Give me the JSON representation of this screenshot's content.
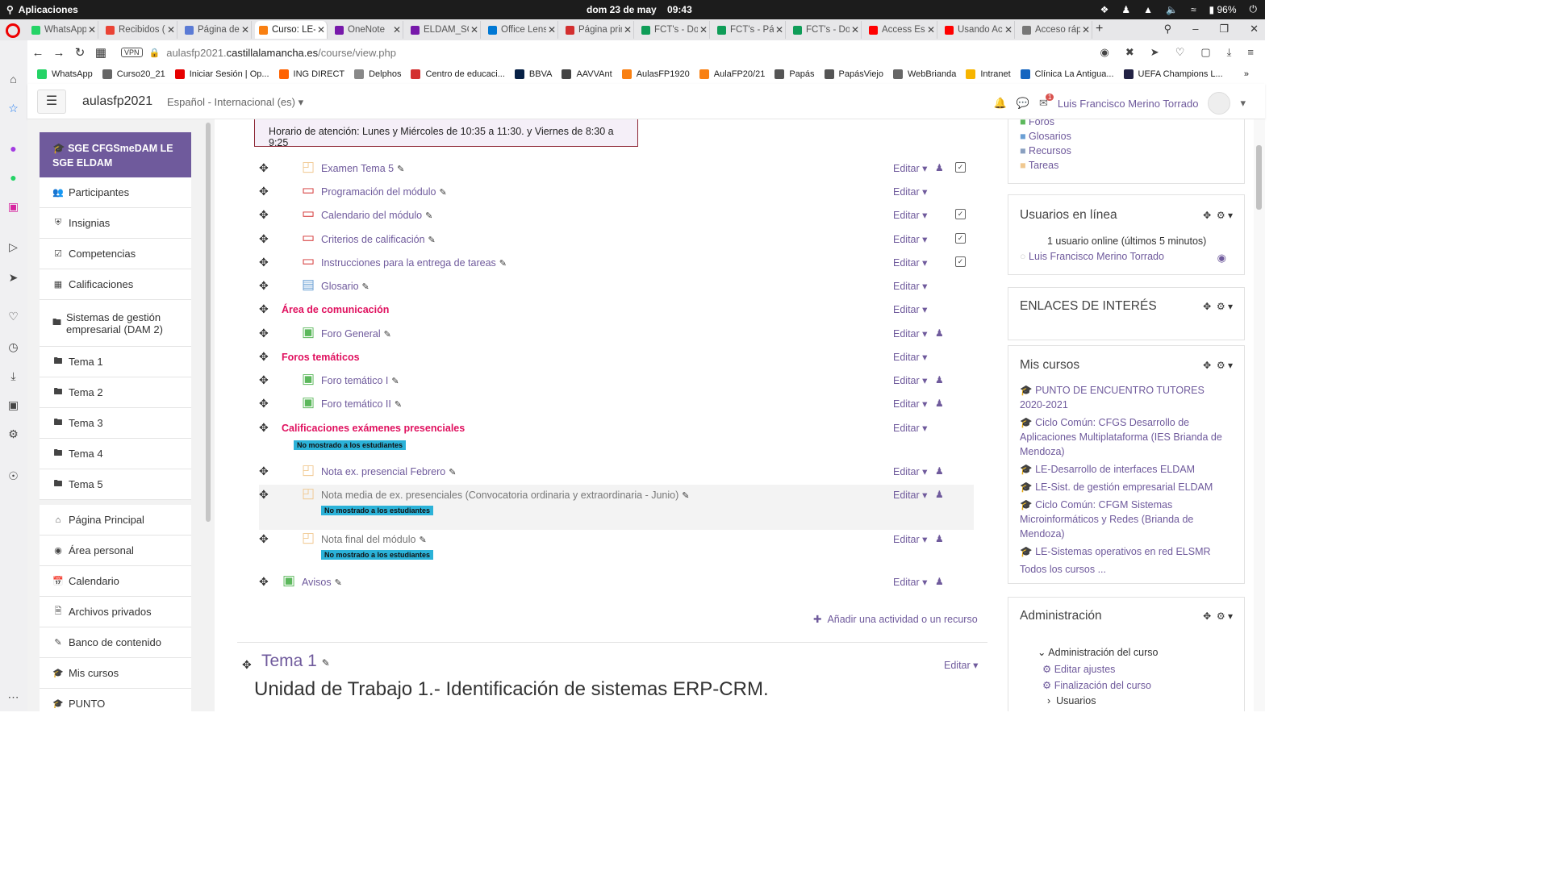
{
  "os": {
    "apps_label": "Aplicaciones",
    "date": "dom 23 de may",
    "time": "09:43",
    "battery": "96%"
  },
  "tabs": [
    {
      "label": "WhatsApp",
      "color": "#25d366"
    },
    {
      "label": "Recibidos (",
      "color": "#ea4335"
    },
    {
      "label": "Página de l",
      "color": "#5b7bd5"
    },
    {
      "label": "Curso: LE-S",
      "color": "#f98012"
    },
    {
      "label": "OneNote",
      "color": "#7719aa"
    },
    {
      "label": "ELDAM_SG",
      "color": "#7719aa"
    },
    {
      "label": "Office Lens",
      "color": "#0078d4"
    },
    {
      "label": "Página prin",
      "color": "#d32f2f"
    },
    {
      "label": "FCT's - Doc",
      "color": "#0f9d58"
    },
    {
      "label": "FCT's - Pág",
      "color": "#0f9d58"
    },
    {
      "label": "FCT's - Doc",
      "color": "#0f9d58"
    },
    {
      "label": "Access Esp",
      "color": "#ff0000"
    },
    {
      "label": "Usando Ac",
      "color": "#ff0000"
    },
    {
      "label": "Acceso ráp",
      "color": "#777777"
    }
  ],
  "address": {
    "vpn": "VPN",
    "url_pre": "aulasfp2021.",
    "url_host": "castillalamancha.es",
    "url_path": "/course/view.php"
  },
  "bookmarks": [
    {
      "label": "WhatsApp",
      "color": "#25d366"
    },
    {
      "label": "Curso20_21",
      "color": "#666666"
    },
    {
      "label": "Iniciar Sesión | Op...",
      "color": "#e60000"
    },
    {
      "label": "ING DIRECT",
      "color": "#ff6200"
    },
    {
      "label": "Delphos",
      "color": "#888888"
    },
    {
      "label": "Centro de educaci...",
      "color": "#d32f2f"
    },
    {
      "label": "BBVA",
      "color": "#072146"
    },
    {
      "label": "AAVVAnt",
      "color": "#444444"
    },
    {
      "label": "AulasFP1920",
      "color": "#f98012"
    },
    {
      "label": "AulaFP20/21",
      "color": "#f98012"
    },
    {
      "label": "Papás",
      "color": "#555555"
    },
    {
      "label": "PapásViejo",
      "color": "#555555"
    },
    {
      "label": "WebBrianda",
      "color": "#666666"
    },
    {
      "label": "Intranet",
      "color": "#f7b500"
    },
    {
      "label": "Clínica La Antigua...",
      "color": "#1565c0"
    },
    {
      "label": "UEFA Champions L...",
      "color": "#222244"
    }
  ],
  "navbar": {
    "site_name": "aulasfp2021",
    "language": "Español - Internacional (es)",
    "user_name": "Luis Francisco Merino Torrado",
    "notif_count": "1"
  },
  "drawer": {
    "course": "SGE CFGSmeDAM LE SGE ELDAM",
    "items": [
      {
        "label": "Participantes",
        "icon": "users-icon"
      },
      {
        "label": "Insignias",
        "icon": "shield-icon"
      },
      {
        "label": "Competencias",
        "icon": "checkbox-icon"
      },
      {
        "label": "Calificaciones",
        "icon": "table-icon"
      },
      {
        "label": "Sistemas de gestión empresarial (DAM 2)",
        "icon": "folder-icon"
      },
      {
        "label": "Tema 1",
        "icon": "folder-icon"
      },
      {
        "label": "Tema 2",
        "icon": "folder-icon"
      },
      {
        "label": "Tema 3",
        "icon": "folder-icon"
      },
      {
        "label": "Tema 4",
        "icon": "folder-icon"
      },
      {
        "label": "Tema 5",
        "icon": "folder-icon"
      }
    ],
    "items2": [
      {
        "label": "Página Principal",
        "icon": "home-icon"
      },
      {
        "label": "Área personal",
        "icon": "dashboard-icon"
      },
      {
        "label": "Calendario",
        "icon": "calendar-icon"
      },
      {
        "label": "Archivos privados",
        "icon": "file-icon"
      },
      {
        "label": "Banco de contenido",
        "icon": "brush-icon"
      },
      {
        "label": "Mis cursos",
        "icon": "graduation-cap-icon"
      },
      {
        "label": "PUNTO",
        "icon": "graduation-cap-icon"
      }
    ]
  },
  "main": {
    "info": "Horario de atención: Lunes y Miércoles de 10:35 a 11:30. y Viernes de 8:30 a 9:25",
    "edit_label": "Editar",
    "hidden_label": "No mostrado a los estudiantes",
    "activities": [
      {
        "name": "Examen Tema 5",
        "icon": "assignment-icon",
        "person": true,
        "check": true
      },
      {
        "name": "Programación del módulo",
        "icon": "pdf-icon",
        "person": false,
        "check": false
      },
      {
        "name": "Calendario del módulo",
        "icon": "pdf-icon",
        "person": false,
        "check": true
      },
      {
        "name": "Criterios de calificación",
        "icon": "pdf-icon",
        "person": false,
        "check": true
      },
      {
        "name": "Instrucciones para la entrega de tareas",
        "icon": "pdf-icon",
        "person": false,
        "check": true
      },
      {
        "name": "Glosario",
        "icon": "glossary-icon",
        "person": false,
        "check": false
      },
      {
        "label": "Área de comunicación"
      },
      {
        "name": "Foro General",
        "icon": "forum-icon",
        "person": true,
        "check": false
      },
      {
        "label": "Foros temáticos"
      },
      {
        "name": "Foro temático I",
        "icon": "forum-icon",
        "person": true,
        "check": false
      },
      {
        "name": "Foro temático II",
        "icon": "forum-icon",
        "person": true,
        "check": false
      },
      {
        "label": "Calificaciones exámenes presenciales"
      },
      {
        "name": "Nota ex. presencial Febrero",
        "icon": "assignment-icon",
        "person": true,
        "check": false
      },
      {
        "name": "Nota media de ex. presenciales (Convocatoria ordinaria y extraordinaria - Junio)",
        "icon": "assignment-icon",
        "person": true,
        "check": false
      },
      {
        "name": "Nota final del módulo",
        "icon": "assignment-icon",
        "person": true,
        "check": false
      },
      {
        "name": "Avisos",
        "icon": "forum-icon",
        "person": true,
        "check": false
      }
    ],
    "add_activity": "Añadir una actividad o un recurso",
    "tema_title": "Tema 1",
    "unit_title": "Unidad de Trabajo 1.- Identificación de sistemas ERP-CRM."
  },
  "blocks": {
    "activities": [
      "Foros",
      "Glosarios",
      "Recursos",
      "Tareas"
    ],
    "online_title": "Usuarios en línea",
    "online_count": "1 usuario online (últimos 5 minutos)",
    "online_user": "Luis Francisco Merino Torrado",
    "links_title": "ENLACES DE INTERÉS",
    "courses_title": "Mis cursos",
    "courses": [
      "PUNTO DE ENCUENTRO TUTORES 2020-2021",
      "Ciclo Común: CFGS Desarrollo de Aplicaciones Multiplataforma (IES Brianda de Mendoza)",
      "LE-Desarrollo de interfaces ELDAM",
      "LE-Sist. de gestión empresarial ELDAM",
      "Ciclo Común: CFGM Sistemas Microinformáticos y Redes (Brianda de Mendoza)",
      "LE-Sistemas operativos en red ELSMR"
    ],
    "all_courses": "Todos los cursos ...",
    "admin_title": "Administración",
    "admin_course": "Administración del curso",
    "admin_items": [
      "Editar ajustes",
      "Finalización del curso"
    ],
    "admin_users": "Usuarios"
  },
  "colors": {
    "brand": "#6f5a9c",
    "section_label": "#e0115f",
    "hidden_badge": "#2bb2d8"
  }
}
